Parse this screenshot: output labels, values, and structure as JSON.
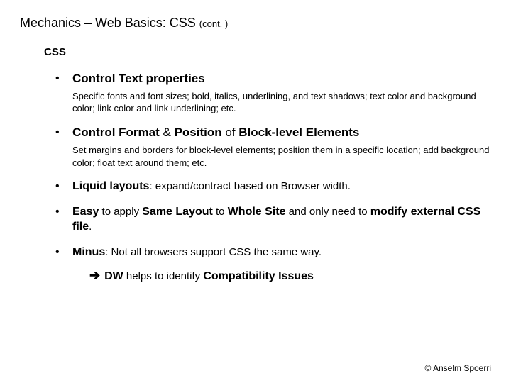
{
  "title": {
    "main": "Mechanics – Web Basics: CSS",
    "cont": "(cont. )"
  },
  "section_heading": "CSS",
  "bullets": {
    "b1": {
      "head": "Control Text properties",
      "desc": "Specific fonts and font sizes; bold, italics, underlining, and text shadows; text color and background color; link color and link underlining; etc."
    },
    "b2": {
      "head_strong1": "Control Format",
      "amp": " & ",
      "head_strong2": "Position",
      "of": " of ",
      "head_strong3": "Block-level Elements",
      "desc": "Set margins and borders for block-level elements; position them in a specific location; add background color; float text around them; etc."
    },
    "b3": {
      "strong": "Liquid layouts",
      "rest": ": expand/contract based on Browser width."
    },
    "b4": {
      "s1": "Easy",
      "p1": " to apply ",
      "s2": "Same Layout",
      "p2": " to ",
      "s3": "Whole Site",
      "p3": " and only need to ",
      "s4": "modify external CSS file",
      "p4": "."
    },
    "b5": {
      "s1": "Minus",
      "rest": ": Not all browsers support CSS the same way.",
      "arrow": "➔",
      "dw": "DW",
      "p1": " helps to identify ",
      "s2": "Compatibility Issues"
    }
  },
  "footer": "© Anselm Spoerri"
}
